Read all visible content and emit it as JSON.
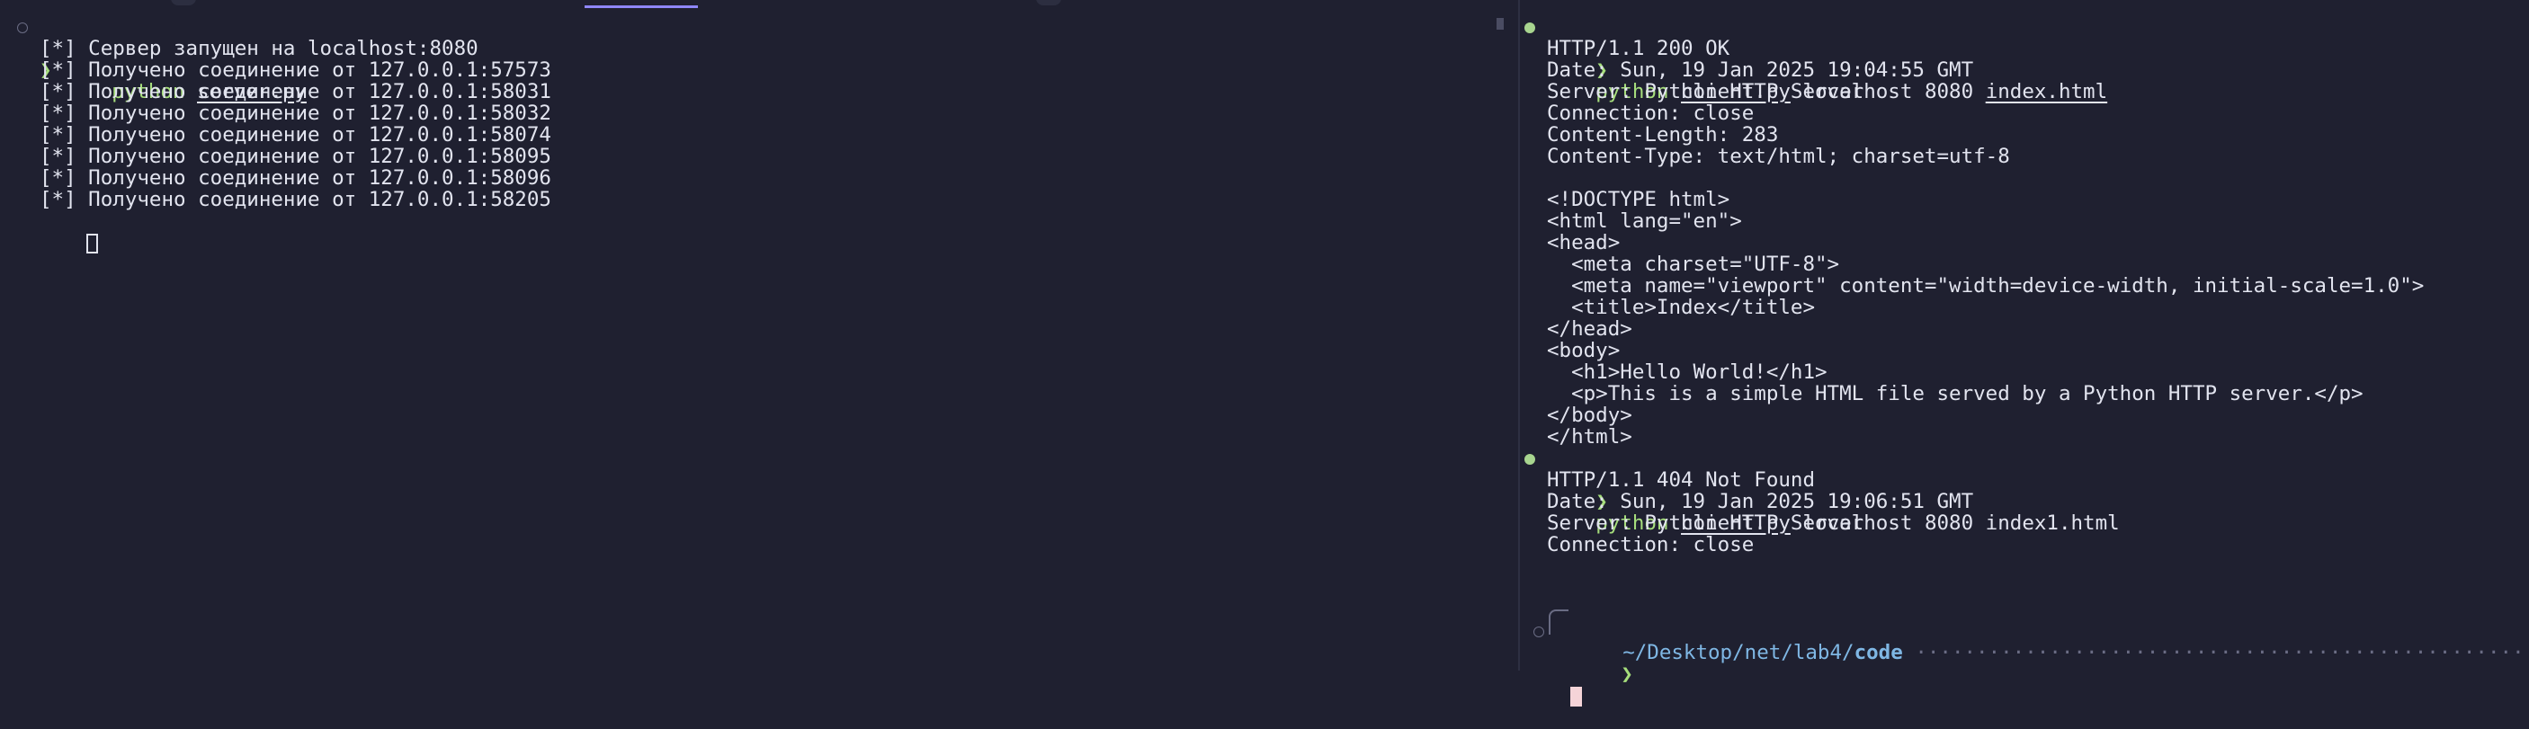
{
  "colors": {
    "background": "#1f2030",
    "prompt_green": "#a6de7c",
    "path_blue": "#7fb7e4",
    "text": "#e2e4ef"
  },
  "left_pane": {
    "prompt_symbol": "❯",
    "command": "python",
    "command_file": "server.py",
    "output": [
      "[*] Сервер запущен на localhost:8080",
      "[*] Получено соединение от 127.0.0.1:57573",
      "[*] Получено соединение от 127.0.0.1:58031",
      "[*] Получено соединение от 127.0.0.1:58032",
      "[*] Получено соединение от 127.0.0.1:58074",
      "[*] Получено соединение от 127.0.0.1:58095",
      "[*] Получено соединение от 127.0.0.1:58096",
      "[*] Получено соединение от 127.0.0.1:58205"
    ]
  },
  "right_pane": {
    "cmd1": {
      "prompt_symbol": "❯",
      "command": "python",
      "file": "client.py",
      "args": "localhost 8080",
      "target": "index.html"
    },
    "output1": [
      "HTTP/1.1 200 OK",
      "Date: Sun, 19 Jan 2025 19:04:55 GMT",
      "Server: Python HTTP Server",
      "Connection: close",
      "Content-Length: 283",
      "Content-Type: text/html; charset=utf-8",
      "",
      "<!DOCTYPE html>",
      "<html lang=\"en\">",
      "<head>",
      "  <meta charset=\"UTF-8\">",
      "  <meta name=\"viewport\" content=\"width=device-width, initial-scale=1.0\">",
      "  <title>Index</title>",
      "</head>",
      "<body>",
      "  <h1>Hello World!</h1>",
      "  <p>This is a simple HTML file served by a Python HTTP server.</p>",
      "</body>",
      "</html>"
    ],
    "cmd2": {
      "prompt_symbol": "❯",
      "command": "python",
      "file": "client.py",
      "args": "localhost 8080 index1.html"
    },
    "output2": [
      "HTTP/1.1 404 Not Found",
      "Date: Sun, 19 Jan 2025 19:06:51 GMT",
      "Server: Python HTTP Server",
      "Connection: close"
    ],
    "cwd_prefix": "~/Desktop/net/lab4/",
    "cwd_dir": "code",
    "prompt_symbol": "❯"
  }
}
